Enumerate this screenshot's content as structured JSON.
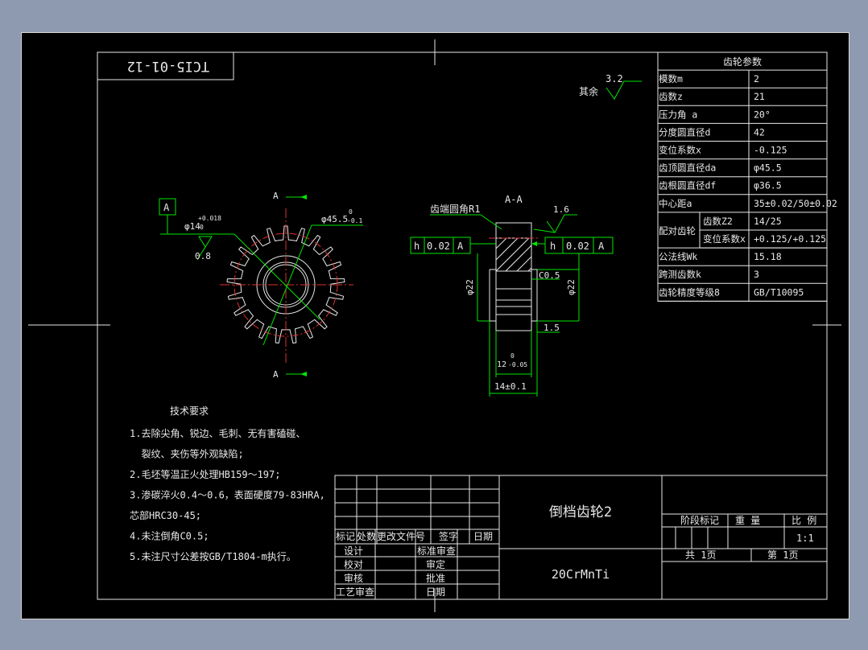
{
  "drawing_number": "TCI5-01-12",
  "roughness": {
    "remaining_label": "其余",
    "remaining_value": "3.2",
    "profile_value": "1.6",
    "bore_value": "0.8"
  },
  "datum": {
    "label": "A"
  },
  "section": {
    "cut_letter_top": "A",
    "cut_letter_bottom": "A",
    "title": "A-A"
  },
  "dims": {
    "bore": "φ14",
    "bore_upper": "+0.018",
    "bore_lower": "0",
    "tip_dia": "φ45.5",
    "tip_upper": "0",
    "tip_lower": "-0.1",
    "fillet": "齿端圆角R1",
    "chamfer": "C0.5",
    "step": "1.5",
    "width_inner": "12",
    "width_inner_upper": "0",
    "width_inner_lower": "-0.05",
    "width_outer": "14±0.1",
    "dia_left": "φ22",
    "dia_right": "φ22"
  },
  "tolerance_frames": {
    "left": {
      "symbol": "h",
      "value": "0.02",
      "datum": "A"
    },
    "right": {
      "symbol": "h",
      "value": "0.02",
      "datum": "A"
    }
  },
  "gear_table": {
    "title": "齿轮参数",
    "rows": [
      {
        "label": "模数m",
        "value": "2"
      },
      {
        "label": "齿数z",
        "value": "21"
      },
      {
        "label": "压力角 a",
        "value": "20°"
      },
      {
        "label": "分度圆直径d",
        "value": "42"
      },
      {
        "label": "变位系数x",
        "value": "-0.125"
      },
      {
        "label": "齿顶圆直径da",
        "value": "φ45.5"
      },
      {
        "label": "齿根圆直径df",
        "value": "φ36.5"
      },
      {
        "label": "中心距a",
        "value": "35±0.02/50±0.02"
      }
    ],
    "mating_label": "配对齿轮",
    "mating_rows": [
      {
        "label": "齿数Z2",
        "value": "14/25"
      },
      {
        "label": "变位系数x",
        "value": "+0.125/+0.125"
      }
    ],
    "rows_after": [
      {
        "label": "公法线Wk",
        "value": "15.18"
      },
      {
        "label": "跨测齿数k",
        "value": "3"
      },
      {
        "label": "齿轮精度等级8",
        "value": "GB/T10095"
      }
    ]
  },
  "notes": {
    "title": "技术要求",
    "lines": [
      "1.去除尖角、锐边、毛刺、无有害磕碰、",
      "  裂纹、夹伤等外观缺陷;",
      "2.毛坯等温正火处理HB159～197;",
      "3.渗碳淬火0.4～0.6，表面硬度79-83HRA,",
      "芯部HRC30-45;",
      "4.未注倒角C0.5;",
      "5.未注尺寸公差按GB/T1804-m执行。"
    ]
  },
  "title_block": {
    "part_name": "倒档齿轮2",
    "material": "20CrMnTi",
    "hdr": [
      "标记",
      "处数",
      "更改文件号",
      "签字",
      "日期"
    ],
    "sign_left": [
      "设计",
      "校对",
      "审核",
      "工艺审查"
    ],
    "sign_right": [
      "标准审查",
      "审定",
      "批准",
      "日期"
    ],
    "stage_label": "阶段标记",
    "weight_label": "重 量",
    "scale_label": "比 例",
    "scale_value": "1:1",
    "total_sheets": "共 1页",
    "sheet_no": "第 1页"
  }
}
